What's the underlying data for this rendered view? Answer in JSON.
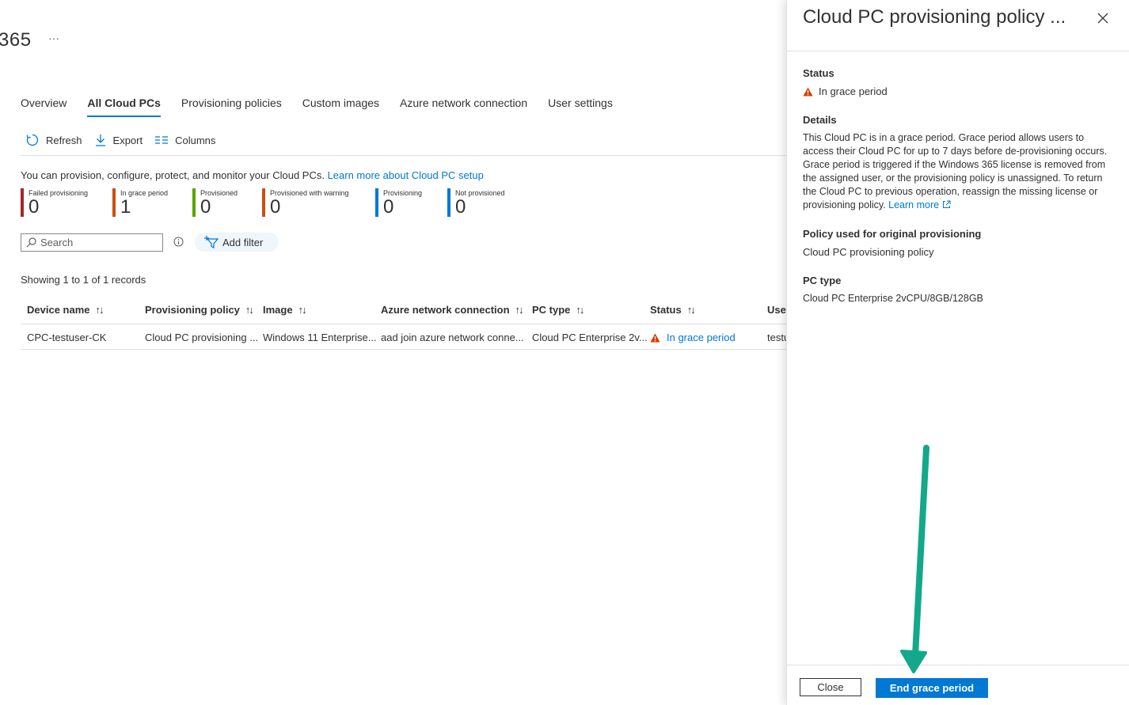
{
  "page": {
    "title": "365",
    "more": "···"
  },
  "tabs": [
    {
      "label": "Overview"
    },
    {
      "label": "All Cloud PCs"
    },
    {
      "label": "Provisioning policies"
    },
    {
      "label": "Custom images"
    },
    {
      "label": "Azure network connection"
    },
    {
      "label": "User settings"
    }
  ],
  "active_tab": "All Cloud PCs",
  "toolbar": {
    "refresh": "Refresh",
    "export": "Export",
    "columns": "Columns"
  },
  "description": {
    "text": "You can provision, configure, protect, and monitor your Cloud PCs. ",
    "link": "Learn more about Cloud PC setup"
  },
  "tiles": [
    {
      "label": "Failed provisioning",
      "value": "0",
      "color": "#a4262c"
    },
    {
      "label": "In grace period",
      "value": "1",
      "color": "#ca5010"
    },
    {
      "label": "Provisioned",
      "value": "0",
      "color": "#57a300"
    },
    {
      "label": "Provisioned with warning",
      "value": "0",
      "color": "#ca5010"
    },
    {
      "label": "Provisioning",
      "value": "0",
      "color": "#0078d4"
    },
    {
      "label": "Not provisioned",
      "value": "0",
      "color": "#0078d4"
    }
  ],
  "search": {
    "placeholder": "Search"
  },
  "add_filter": "Add filter",
  "records": "Showing 1 to 1 of 1 records",
  "table": {
    "columns": [
      "Device name",
      "Provisioning policy",
      "Image",
      "Azure network connection",
      "PC type",
      "Status",
      "User"
    ],
    "sort_glyph": "↑↓",
    "rows": [
      {
        "device": "CPC-testuser-CK",
        "policy": "Cloud PC provisioning ...",
        "image": "Windows 11 Enterprise...",
        "network": "aad join azure network conne...",
        "pc_type": "Cloud PC Enterprise 2v...",
        "status": "In grace period",
        "user": "testu"
      }
    ]
  },
  "panel": {
    "title": "Cloud PC provisioning policy ...",
    "status_heading": "Status",
    "status_value": "In grace period",
    "details_heading": "Details",
    "details_text": "This Cloud PC is in a grace period. Grace period allows users to access their Cloud PC for up to 7 days before de-provisioning occurs. Grace period is triggered if the Windows 365 license is removed from the assigned user, or the provisioning policy is unassigned. To return the Cloud PC to previous operation, reassign the missing license or provisioning policy. ",
    "learn_more": "Learn more",
    "policy_heading": "Policy used for original provisioning",
    "policy_link": "Cloud PC provisioning policy",
    "pc_type_heading": "PC type",
    "pc_type_value": "Cloud PC Enterprise 2vCPU/8GB/128GB",
    "close_button": "Close",
    "end_button": "End grace period"
  },
  "colors": {
    "accent": "#0078d4",
    "warning": "#d83b01",
    "annotation_arrow": "#13a88a"
  }
}
